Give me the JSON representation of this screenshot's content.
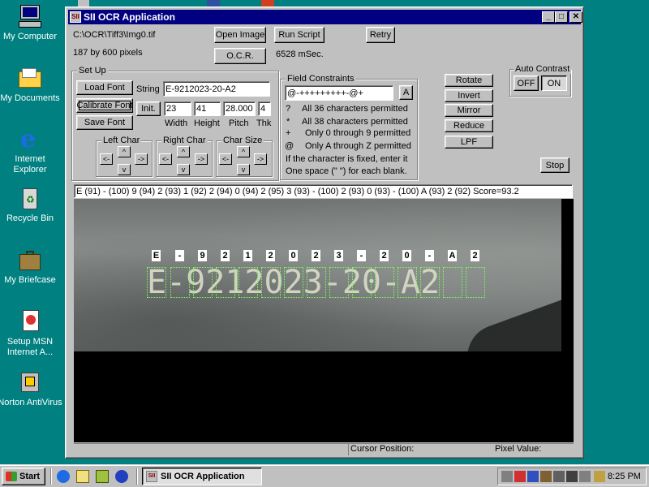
{
  "desktop": {
    "icons": [
      {
        "label": "My Computer"
      },
      {
        "label": "My Documents"
      },
      {
        "label": "Internet Explorer"
      },
      {
        "label": "Recycle Bin"
      },
      {
        "label": "My Briefcase"
      },
      {
        "label": "Setup MSN Internet A..."
      },
      {
        "label": "Norton AntiVirus"
      }
    ]
  },
  "window": {
    "title": "SII OCR Application",
    "file_path": "C:\\OCR\\Tiff3\\Img0.tif",
    "image_size": "187 by 600 pixels",
    "timing": "6528 mSec.",
    "buttons": {
      "open_image": "Open Image",
      "run_script": "Run Script",
      "retry": "Retry",
      "ocr": "O.C.R.",
      "load_font": "Load Font",
      "calibrate_font": "Calibrate Font",
      "save_font": "Save Font",
      "init": "Init.",
      "rotate": "Rotate",
      "invert": "Invert",
      "mirror": "Mirror",
      "reduce": "Reduce",
      "lpf": "LPF",
      "stop": "Stop",
      "constraint_a": "A"
    },
    "setup": {
      "group_title": "Set Up",
      "string_label": "String",
      "string_value": "E-9212023-20-A2",
      "width_value": "23",
      "height_value": "41",
      "pitch_value": "28.000",
      "thk_value": "4",
      "width_label": "Width",
      "height_label": "Height",
      "pitch_label": "Pitch",
      "thk_label": "Thk",
      "left_char": "Left Char",
      "right_char": "Right Char",
      "char_size": "Char Size",
      "arrow_left": "<-",
      "arrow_right": "->",
      "arrow_up": "^",
      "arrow_down": "v"
    },
    "field_constraints": {
      "title": "Field Constraints",
      "value": "@-+++++++++-@+",
      "rows": [
        {
          "symbol": "?",
          "text": "All 36 characters permitted"
        },
        {
          "symbol": "*",
          "text": "All 38 characters permitted"
        },
        {
          "symbol": "+",
          "text": "Only 0 through 9 permitted"
        },
        {
          "symbol": "@",
          "text": "Only A through Z permitted"
        }
      ],
      "note1": "If the character is fixed, enter it",
      "note2": "One space (\" \") for each blank."
    },
    "auto_contrast": {
      "title": "Auto Contrast",
      "off": "OFF",
      "on": "ON"
    },
    "result": "E (91) - (100) 9 (94) 2 (93) 1 (92) 2 (94) 0 (94) 2 (95) 3 (93) - (100) 2 (93) 0 (93) - (100) A (93) 2 (92) Score=93.2",
    "recognized_chars": [
      "E",
      "-",
      "9",
      "2",
      "1",
      "2",
      "0",
      "2",
      "3",
      "-",
      "2",
      "0",
      "-",
      "A",
      "2"
    ],
    "image_text": "E-9212023-20-A2",
    "status": {
      "cursor_label": "Cursor Position:",
      "pixel_label": "Pixel Value:"
    }
  },
  "taskbar": {
    "start": "Start",
    "task": "SII OCR Application",
    "clock": "8:25 PM"
  }
}
